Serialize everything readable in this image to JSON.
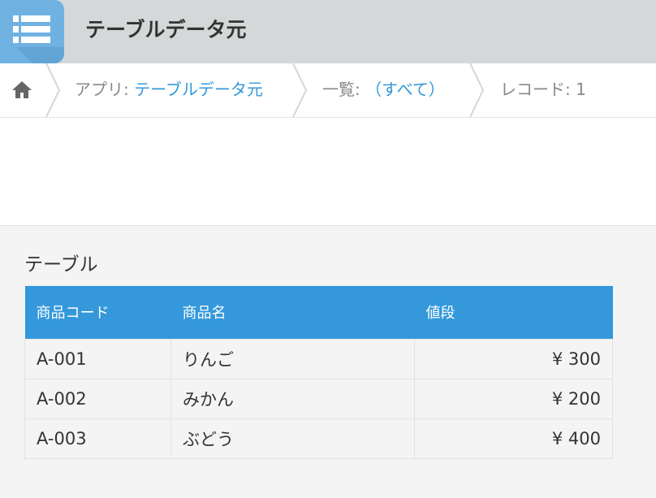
{
  "header": {
    "app_icon": "table-list-icon",
    "title": "テーブルデータ元"
  },
  "breadcrumb": {
    "home_icon": "home-icon",
    "app_prefix": "アプリ: ",
    "app_name": "テーブルデータ元",
    "view_prefix": "一覧: ",
    "view_name": "（すべて）",
    "record": "レコード: 1"
  },
  "table_section": {
    "label": "テーブル",
    "columns": [
      "商品コード",
      "商品名",
      "値段"
    ],
    "rows": [
      {
        "code": "A-001",
        "name": "りんご",
        "price": "¥ 300"
      },
      {
        "code": "A-002",
        "name": "みかん",
        "price": "¥ 200"
      },
      {
        "code": "A-003",
        "name": "ぶどう",
        "price": "¥ 400"
      }
    ]
  },
  "colors": {
    "header_bg": "#d5d8d9",
    "app_icon_bg": "#6fb2e2",
    "table_header_bg": "#3498db",
    "link": "#3498db"
  }
}
